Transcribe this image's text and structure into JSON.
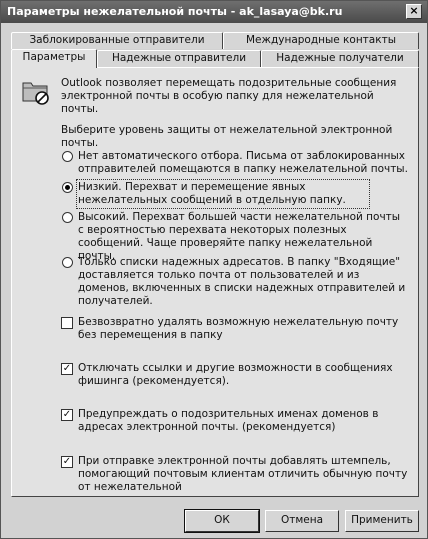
{
  "window": {
    "title": "Параметры нежелательной почты - ak_lasaya@bk.ru",
    "close": "×"
  },
  "tabs": {
    "row_back": [
      "Заблокированные отправители",
      "Международные контакты"
    ],
    "row_front": [
      "Параметры",
      "Надежные отправители",
      "Надежные получатели"
    ]
  },
  "content": {
    "intro": "Outlook позволяет перемещать подозрительные сообщения электронной почты в особую папку для нежелательной почты.",
    "prompt": "Выберите уровень защиты от нежелательной электронной почты.",
    "radios": [
      {
        "label": "Нет автоматического отбора. Письма от заблокированных отправителей помещаются в папку нежелательной почты.",
        "checked": false
      },
      {
        "label": "Низкий. Перехват и перемещение явных нежелательных сообщений в отдельную папку.",
        "checked": true
      },
      {
        "label": "Высокий. Перехват большей части нежелательной почты с вероятностью перехвата некоторых полезных сообщений. Чаще проверяйте папку нежелательной почты.",
        "checked": false
      },
      {
        "label": "Только списки надежных адресатов. В папку \"Входящие\" доставляется только почта от пользователей и из доменов, включенных в списки надежных отправителей и получателей.",
        "checked": false
      }
    ],
    "checks": [
      {
        "label": "Безвозвратно удалять возможную нежелательную почту без перемещения в папку",
        "checked": false
      },
      {
        "label": "Отключать ссылки и другие возможности в сообщениях фишинга (рекомендуется).",
        "checked": true
      },
      {
        "label": "Предупреждать о подозрительных именах доменов в адресах электронной почты. (рекомендуется)",
        "checked": true
      },
      {
        "label": "При отправке электронной почты добавлять штемпель, помогающий почтовым клиентам отличить обычную почту от нежелательной",
        "checked": true
      }
    ]
  },
  "buttons": {
    "ok": "ОК",
    "cancel": "Отмена",
    "apply": "Применить"
  },
  "icons": {
    "folder": "junk-folder-icon",
    "check_mark": "✓"
  }
}
